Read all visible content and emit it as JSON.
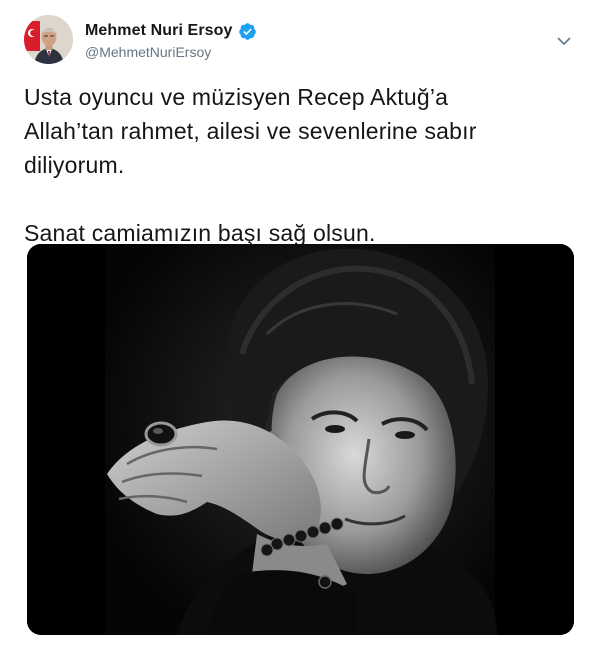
{
  "author": {
    "display_name": "Mehmet Nuri Ersoy",
    "handle": "@MehmetNuriErsoy",
    "verified": true,
    "avatar_icon": "profile-photo-with-flag"
  },
  "menu": {
    "icon": "chevron-down-icon"
  },
  "tweet": {
    "paragraph_1_lines": [
      "Usta oyuncu ve müzisyen Recep Aktuğ’a",
      "Allah’tan rahmet, ailesi ve sevenlerine sabır",
      "diliyorum."
    ],
    "paragraph_2": "Sanat camiamızın başı sağ olsun."
  },
  "media": {
    "kind": "black-and-white portrait photo"
  },
  "colors": {
    "verified_blue": "#1da1f2",
    "handle_gray": "#657786",
    "text": "#14171a"
  }
}
